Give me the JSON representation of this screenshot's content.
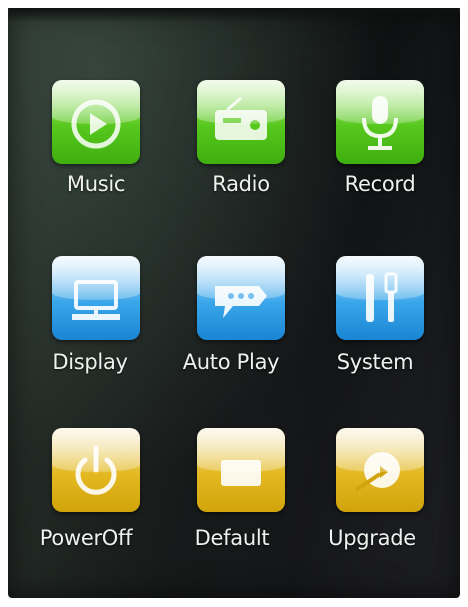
{
  "menu": {
    "items": [
      {
        "label": "Music",
        "icon": "play-circle-icon",
        "color": "#57c81c"
      },
      {
        "label": "Radio",
        "icon": "radio-icon",
        "color": "#57c81c"
      },
      {
        "label": "Record",
        "icon": "microphone-icon",
        "color": "#57c81c"
      },
      {
        "label": "Display",
        "icon": "monitor-icon",
        "color": "#3aa6ea"
      },
      {
        "label": "Auto  Play",
        "icon": "speech-bubble-icon",
        "color": "#3aa6ea"
      },
      {
        "label": "System",
        "icon": "tools-icon",
        "color": "#3aa6ea"
      },
      {
        "label": "PowerOff",
        "icon": "power-icon",
        "color": "#e3b820"
      },
      {
        "label": "Default",
        "icon": "box-icon",
        "color": "#e3b820"
      },
      {
        "label": "Upgrade",
        "icon": "upgrade-arrow-icon",
        "color": "#e3b820"
      }
    ]
  }
}
